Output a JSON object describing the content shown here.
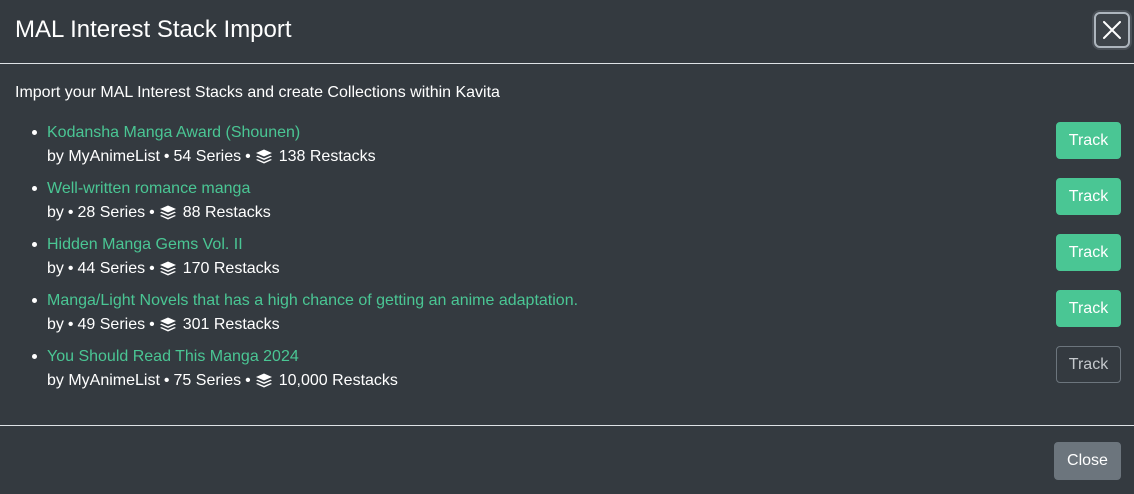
{
  "modal": {
    "title": "MAL Interest Stack Import",
    "close_icon": "close-icon",
    "intro": "Import your MAL Interest Stacks and create Collections within Kavita",
    "stacks": [
      {
        "title": "Kodansha Manga Award (Shounen)",
        "by": "by MyAnimeList",
        "series": "54 Series",
        "restacks": "138 Restacks",
        "button": "Track",
        "tracked": false
      },
      {
        "title": "Well-written romance manga",
        "by": "by",
        "series": "28 Series",
        "restacks": "88 Restacks",
        "button": "Track",
        "tracked": false
      },
      {
        "title": "Hidden Manga Gems Vol. II",
        "by": "by",
        "series": "44 Series",
        "restacks": "170 Restacks",
        "button": "Track",
        "tracked": false
      },
      {
        "title": "Manga/Light Novels that has a high chance of getting an anime adaptation.",
        "by": "by",
        "series": "49 Series",
        "restacks": "301 Restacks",
        "button": "Track",
        "tracked": false
      },
      {
        "title": "You Should Read This Manga 2024",
        "by": "by MyAnimeList",
        "series": "75 Series",
        "restacks": "10,000 Restacks",
        "button": "Track",
        "tracked": true
      }
    ],
    "separator": "•",
    "restack_icon": "layers-icon",
    "close_button": "Close"
  },
  "colors": {
    "background": "#343a40",
    "link": "#4ac694",
    "primary_button": "#4ac694",
    "secondary_button": "#6c757d"
  }
}
